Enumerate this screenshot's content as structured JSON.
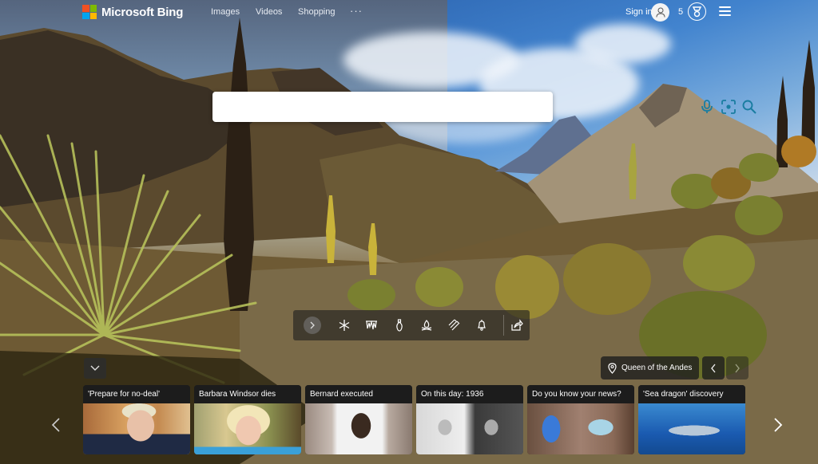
{
  "header": {
    "brand": "Microsoft Bing",
    "logo_colors": [
      "#f25022",
      "#7fba00",
      "#00a4ef",
      "#ffb900"
    ],
    "nav": [
      {
        "label": "Images"
      },
      {
        "label": "Videos"
      },
      {
        "label": "Shopping"
      },
      {
        "label": "···"
      }
    ],
    "sign_in": "Sign in",
    "rewards_points": "5"
  },
  "search": {
    "value": "",
    "placeholder": "",
    "accent": "#1a7da1",
    "icons": [
      "microphone-icon",
      "visual-search-icon",
      "search-icon"
    ]
  },
  "toolbar": {
    "icons": [
      "chevron-right-icon",
      "snowflake-icon",
      "icicles-icon",
      "ornament-bulb-icon",
      "campfire-icon",
      "scarf-icon",
      "bell-icon",
      "share-icon"
    ]
  },
  "image_info": {
    "title": "Queen of the Andes"
  },
  "news": {
    "cards": [
      {
        "title": "'Prepare for no-deal'"
      },
      {
        "title": "Barbara Windsor dies"
      },
      {
        "title": "Bernard executed"
      },
      {
        "title": "On this day: 1936"
      },
      {
        "title": "Do you know your news?"
      },
      {
        "title": "'Sea dragon' discovery"
      }
    ]
  }
}
